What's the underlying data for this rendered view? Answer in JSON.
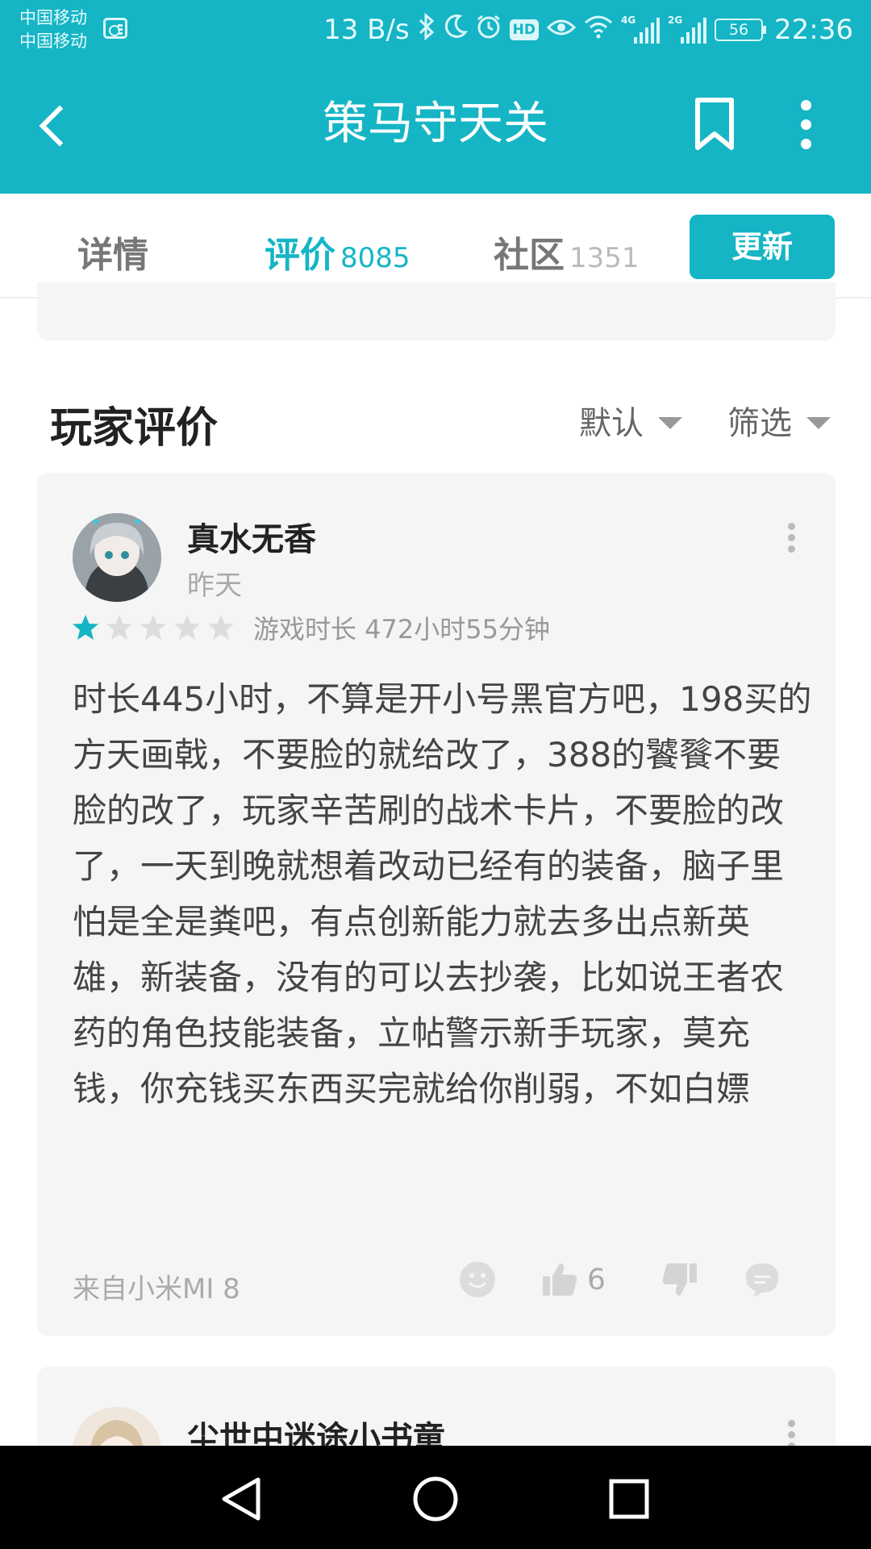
{
  "status_bar": {
    "carrier_1": "中国移动",
    "carrier_2": "中国移动",
    "net_speed": "13 B/s",
    "hd_badge": "HD",
    "signal_1_tag": "4G",
    "signal_2_tag": "2G",
    "battery": "56",
    "time": "22:36",
    "icons": [
      "radio-icon",
      "bluetooth-icon",
      "moon-icon",
      "alarm-icon",
      "eye-icon",
      "wifi-icon"
    ]
  },
  "app_bar": {
    "title": "策马守天关",
    "icons": [
      "back-arrow-icon",
      "bookmark-icon",
      "more-vertical-icon"
    ]
  },
  "tabs": [
    {
      "label": "详情",
      "count": ""
    },
    {
      "label": "评价",
      "count": "8085"
    },
    {
      "label": "社区",
      "count": "1351"
    }
  ],
  "active_tab": "评价",
  "update_button": "更新",
  "section": {
    "title": "玩家评价",
    "sort_label": "默认",
    "filter_label": "筛选"
  },
  "reviews": [
    {
      "username": "真水无香",
      "time": "昨天",
      "rating": 1,
      "max_rating": 5,
      "playtime": "游戏时长 472小时55分钟",
      "text": "时长445小时，不算是开小号黑官方吧，198买的方天画戟，不要脸的就给改了，388的饕餮不要脸的改了，玩家辛苦刷的战术卡片，不要脸的改了，一天到晚就想着改动已经有的装备，脑子里怕是全是粪吧，有点创新能力就去多出点新英雄，新装备，没有的可以去抄袭，比如说王者农药的角色技能装备，立帖警示新手玩家，莫充钱，你充钱买东西买完就给你削弱，不如白嫖",
      "device": "来自小米MI 8",
      "likes": "6"
    },
    {
      "username": "尘世中迷途小书童"
    }
  ],
  "colors": {
    "accent": "#15b5c5",
    "card_bg": "#f5f5f5",
    "star_filled": "#15b5c5",
    "star_empty": "#dddddd"
  },
  "nav_icons": [
    "nav-back-icon",
    "nav-home-icon",
    "nav-recents-icon"
  ]
}
